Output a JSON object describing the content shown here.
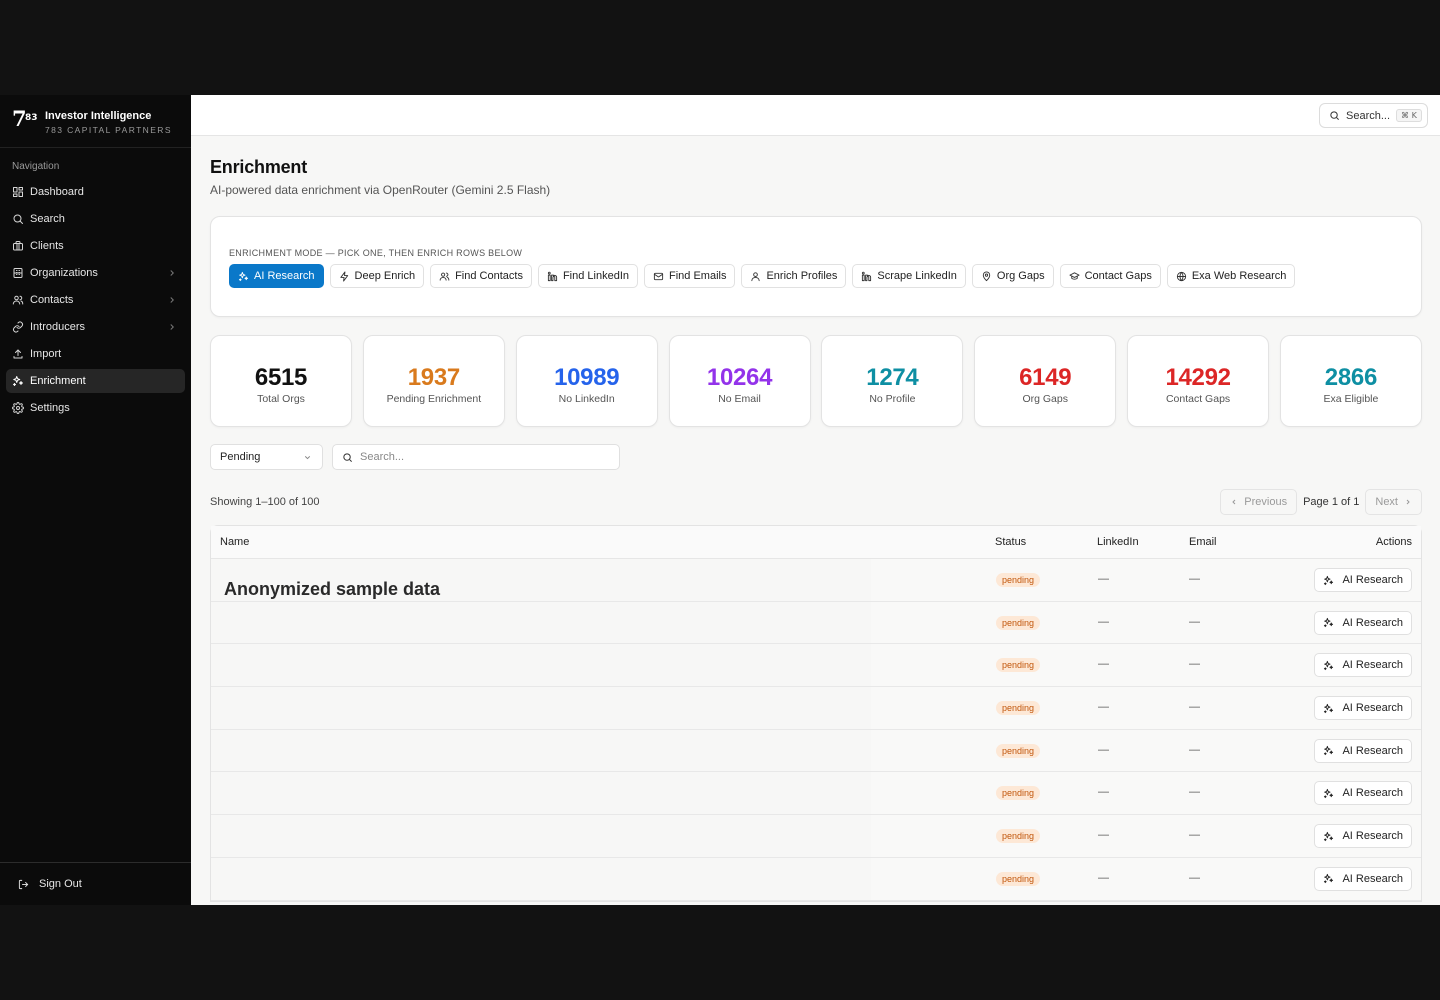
{
  "brand": {
    "logo": "7",
    "logo_sup": "83",
    "title": "Investor Intelligence",
    "subtitle": "783 CAPITAL PARTNERS"
  },
  "sidebar": {
    "heading": "Navigation",
    "items": [
      {
        "label": "Dashboard",
        "icon": "dashboard-icon"
      },
      {
        "label": "Search",
        "icon": "search-icon"
      },
      {
        "label": "Clients",
        "icon": "briefcase-icon"
      },
      {
        "label": "Organizations",
        "icon": "building-icon",
        "expandable": true
      },
      {
        "label": "Contacts",
        "icon": "users-icon",
        "expandable": true
      },
      {
        "label": "Introducers",
        "icon": "link-icon",
        "expandable": true
      },
      {
        "label": "Import",
        "icon": "upload-icon"
      },
      {
        "label": "Enrichment",
        "icon": "sparkles-icon",
        "active": true
      },
      {
        "label": "Settings",
        "icon": "gear-icon"
      }
    ],
    "sign_out": "Sign Out"
  },
  "topbar": {
    "search_label": "Search...",
    "shortcut": "⌘ K"
  },
  "page": {
    "title": "Enrichment",
    "subtitle": "AI-powered data enrichment via OpenRouter (Gemini 2.5 Flash)"
  },
  "mode": {
    "label": "Enrichment mode — pick one, then enrich rows below",
    "buttons": [
      {
        "label": "AI Research",
        "icon": "sparkles-icon",
        "active": true
      },
      {
        "label": "Deep Enrich",
        "icon": "zap-icon"
      },
      {
        "label": "Find Contacts",
        "icon": "users-icon"
      },
      {
        "label": "Find LinkedIn",
        "icon": "linkedin-icon"
      },
      {
        "label": "Find Emails",
        "icon": "mail-icon"
      },
      {
        "label": "Enrich Profiles",
        "icon": "user-icon"
      },
      {
        "label": "Scrape LinkedIn",
        "icon": "linkedin-icon"
      },
      {
        "label": "Org Gaps",
        "icon": "map-pin-icon"
      },
      {
        "label": "Contact Gaps",
        "icon": "graduation-cap-icon"
      },
      {
        "label": "Exa Web Research",
        "icon": "globe-icon"
      }
    ]
  },
  "stats": [
    {
      "value": "6515",
      "label": "Total Orgs",
      "color": "#111111"
    },
    {
      "value": "1937",
      "label": "Pending Enrichment",
      "color": "#d97a1d"
    },
    {
      "value": "10989",
      "label": "No LinkedIn",
      "color": "#2563eb"
    },
    {
      "value": "10264",
      "label": "No Email",
      "color": "#9333ea"
    },
    {
      "value": "1274",
      "label": "No Profile",
      "color": "#0e8fa3"
    },
    {
      "value": "6149",
      "label": "Org Gaps",
      "color": "#dc2626"
    },
    {
      "value": "14292",
      "label": "Contact Gaps",
      "color": "#dc2626"
    },
    {
      "value": "2866",
      "label": "Exa Eligible",
      "color": "#0e8fa3"
    }
  ],
  "filters": {
    "status_value": "Pending",
    "search_placeholder": "Search..."
  },
  "pagination": {
    "showing": "Showing 1–100 of 100",
    "previous": "Previous",
    "page_of": "Page 1 of 1",
    "next": "Next"
  },
  "table": {
    "columns": {
      "name": "Name",
      "status": "Status",
      "linkedin": "LinkedIn",
      "email": "Email",
      "actions": "Actions"
    },
    "overlay_text": "Anonymized sample data",
    "rows": [
      {
        "status": "pending",
        "linkedin": "—",
        "email": "—",
        "action": "AI Research"
      },
      {
        "status": "pending",
        "linkedin": "—",
        "email": "—",
        "action": "AI Research"
      },
      {
        "status": "pending",
        "linkedin": "—",
        "email": "—",
        "action": "AI Research"
      },
      {
        "status": "pending",
        "linkedin": "—",
        "email": "—",
        "action": "AI Research"
      },
      {
        "status": "pending",
        "linkedin": "—",
        "email": "—",
        "action": "AI Research"
      },
      {
        "status": "pending",
        "linkedin": "—",
        "email": "—",
        "action": "AI Research"
      },
      {
        "status": "pending",
        "linkedin": "—",
        "email": "—",
        "action": "AI Research"
      },
      {
        "status": "pending",
        "linkedin": "—",
        "email": "—",
        "action": "AI Research"
      }
    ]
  },
  "colors": {
    "accent": "#0a78c9",
    "sidebar_bg": "#0b0b0b",
    "pending_badge_bg": "#fde8d6",
    "pending_badge_text": "#c2570c"
  }
}
